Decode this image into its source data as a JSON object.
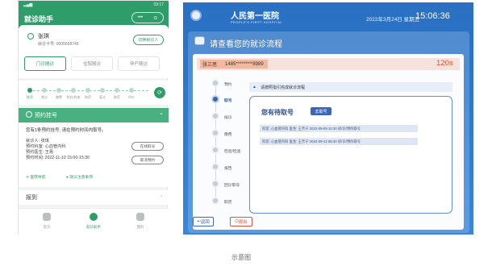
{
  "phone": {
    "status_time": "09:17",
    "title": "就诊助手",
    "capsule": {
      "more": "•••",
      "close": "⊙"
    },
    "patient": {
      "name": "张琪",
      "card": "就诊卡号: 0005698745",
      "switch_label": "切换就诊人"
    },
    "tabs": [
      {
        "label": "门诊随诊",
        "active": true
      },
      {
        "label": "住院随访",
        "active": false
      },
      {
        "label": "孕产随访",
        "active": false
      }
    ],
    "steps": [
      "挂号",
      "就诊",
      "缴费",
      "检验/检查",
      "取药",
      "复诊",
      "取药",
      "评价"
    ],
    "go_icon": "refresh-icon",
    "accordion": {
      "title": "预约挂号",
      "tip": "您有1条预约挂号, 请在预约时间内取号。",
      "fields": [
        "就诊人: 张琪",
        "预约科室: 心血管内科",
        "预约医生: 王易",
        "预约时间: 2022-11-10 15:00-15:30"
      ],
      "buttons": [
        "在线取号",
        "取消预约"
      ],
      "links": [
        "医院导航",
        "就诊注意事项"
      ]
    },
    "row_label": "报到",
    "nav": [
      {
        "label": "首页",
        "active": false
      },
      {
        "label": "就诊助手",
        "active": true
      },
      {
        "label": "我的",
        "active": false
      }
    ]
  },
  "kiosk": {
    "hospital": "人民第一医院",
    "hospital_en": "PEOPLE'S FIRST HOSPITAL",
    "date": "2022年3月24日  星期五",
    "time": "15:06:36",
    "heading": "请查看您的就诊流程",
    "patient_name": "张三思",
    "patient_id": "1485*********8989",
    "countdown": "120s",
    "steps": [
      "预约",
      "取号",
      "候诊",
      "缴费",
      "检验/检查",
      "报告",
      "回诊取号",
      "取药"
    ],
    "active_step": 1,
    "notice": "请按照指引完成就诊流程",
    "wait_title": "您有待取号",
    "take_button": "去取号",
    "records": [
      "科室: 心血管内科    医生: 王芳宁    2022-09-09  10:30  初/诊/预约取号",
      "科室: 心血管内科    医生: 王芳宁    2022-09-12  08:30  初/诊/预约取号"
    ],
    "back_label": "返回",
    "exit_label": "退出"
  },
  "caption": "示意图",
  "colors": {
    "phone_green": "#2f9d6a",
    "kiosk_blue": "#2e7bd0",
    "countdown_red": "#e24f3a"
  }
}
